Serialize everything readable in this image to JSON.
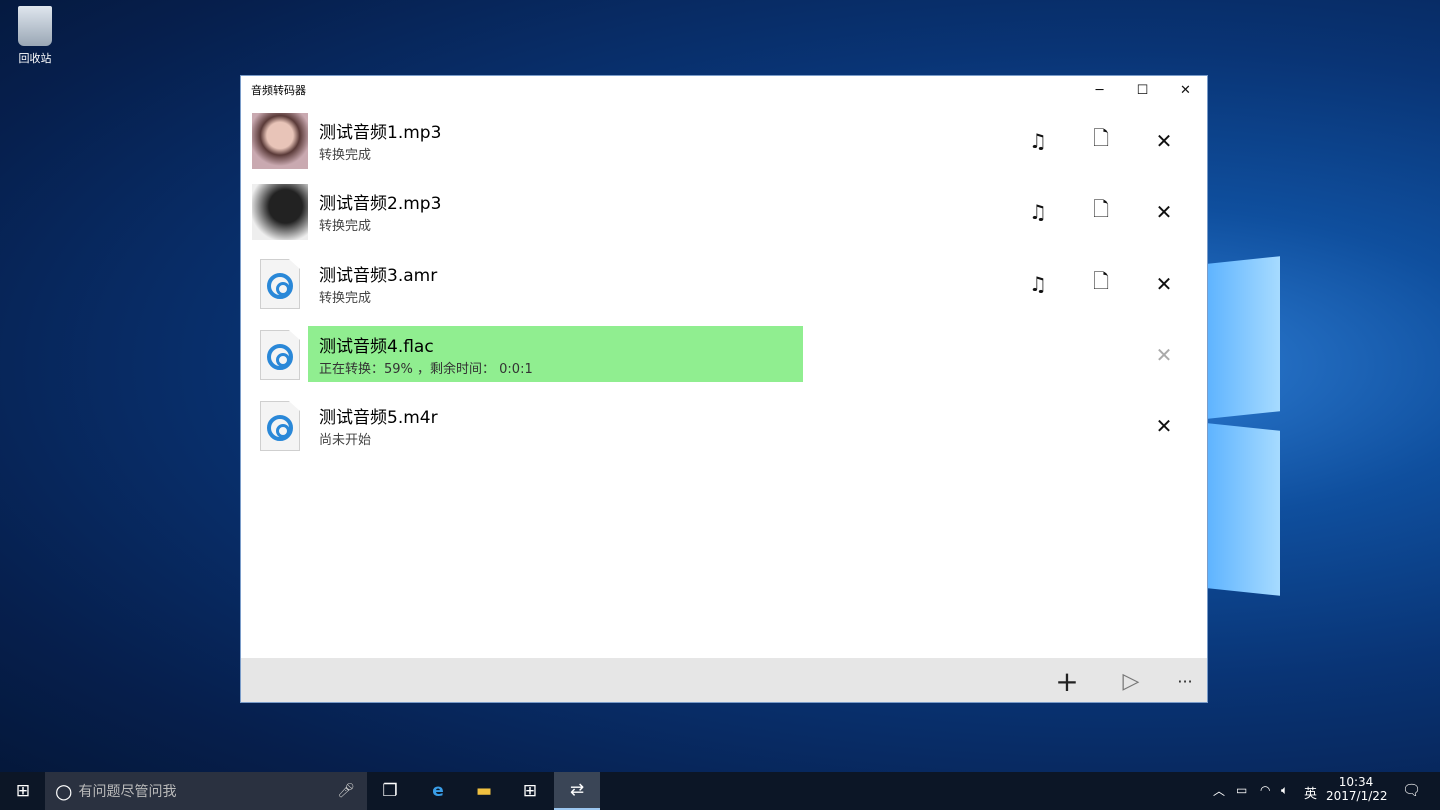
{
  "desktop": {
    "recycle_bin_label": "回收站"
  },
  "window": {
    "title": "音频转码器",
    "minimize": "─",
    "maximize": "☐",
    "close": "✕"
  },
  "files": [
    {
      "name": "测试音频1.mp3",
      "status": "转换完成",
      "thumb": "album-art-portrait",
      "actions": [
        "play-music",
        "open-file",
        "remove"
      ]
    },
    {
      "name": "测试音频2.mp3",
      "status": "转换完成",
      "thumb": "album-art-bw",
      "actions": [
        "play-music",
        "open-file",
        "remove"
      ]
    },
    {
      "name": "测试音频3.amr",
      "status": "转换完成",
      "thumb": "audio-file-icon",
      "actions": [
        "play-music",
        "open-file",
        "remove"
      ]
    },
    {
      "name": "测试音频4.flac",
      "status": "正在转换：59% ，剩余时间： 0:0:1",
      "progress_percent": 59,
      "progress_color": "#90ee90",
      "thumb": "audio-file-icon",
      "actions": [
        "remove-disabled"
      ]
    },
    {
      "name": "测试音频5.m4r",
      "status": "尚未开始",
      "thumb": "audio-file-icon",
      "actions": [
        "remove"
      ]
    }
  ],
  "icons": {
    "music": "♫",
    "file": "🗋",
    "remove": "✕",
    "add": "+",
    "start": "▷",
    "more": "···"
  },
  "taskbar": {
    "search_placeholder": "有问题尽管问我",
    "ime": "英",
    "time": "10:34",
    "date": "2017/1/22"
  }
}
